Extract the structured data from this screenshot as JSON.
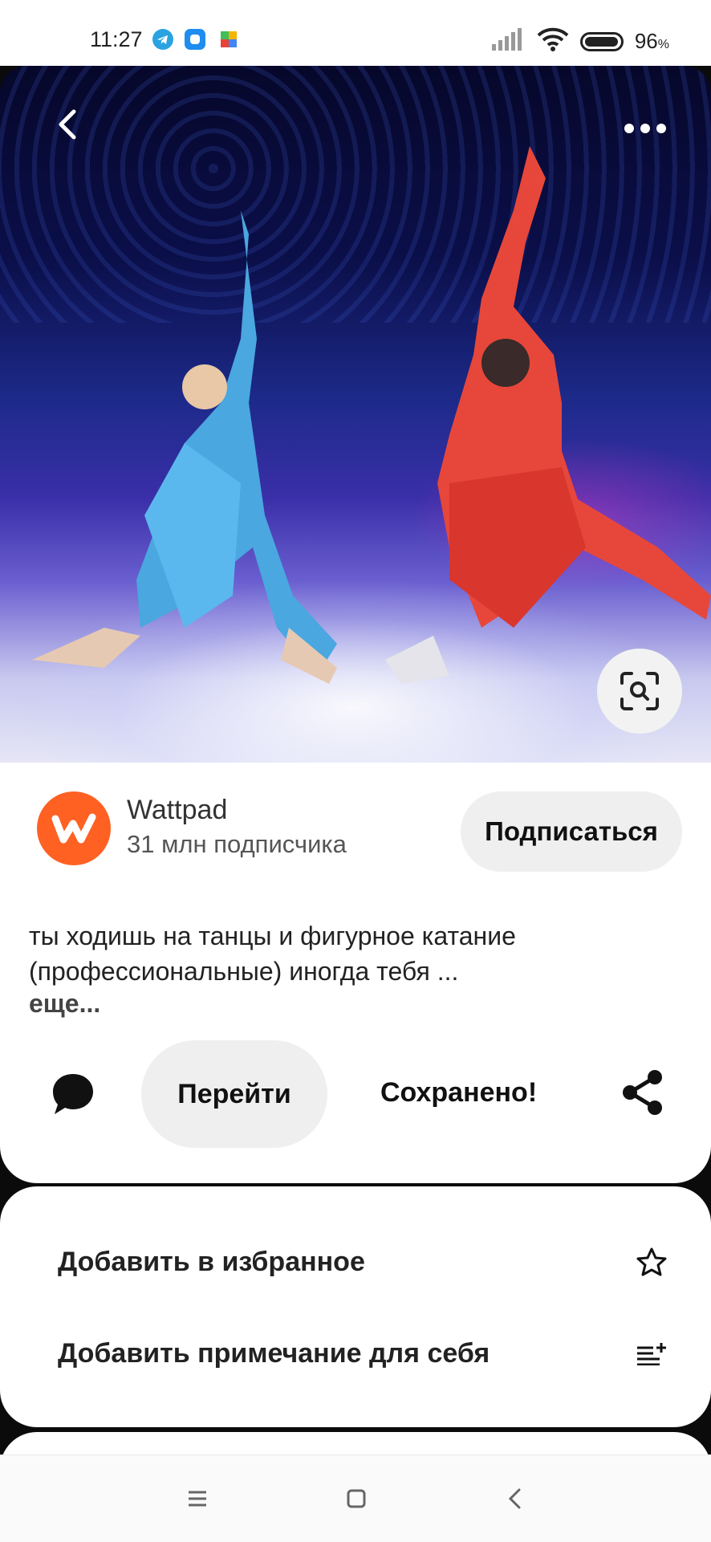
{
  "status_bar": {
    "time": "11:27",
    "battery": "96",
    "battery_unit": "%"
  },
  "pin": {
    "image_alt": "Две фигуристки на льду",
    "author": {
      "name": "Wattpad",
      "subscribers": "31 млн подписчика"
    },
    "follow_label": "Подписаться",
    "description": "ты ходишь на танцы и фигурное катание (профессиональные) иногда тебя ...",
    "more_label": "еще...",
    "actions": {
      "goto_label": "Перейти",
      "saved_label": "Сохранено!"
    }
  },
  "menu": {
    "items": [
      {
        "label": "Добавить в избранное",
        "icon": "star-icon"
      },
      {
        "label": "Добавить примечание для себя",
        "icon": "add-note-icon"
      }
    ]
  },
  "colors": {
    "brand": "#ff6122",
    "pill": "#efefef",
    "background": "#0b0b0b"
  }
}
